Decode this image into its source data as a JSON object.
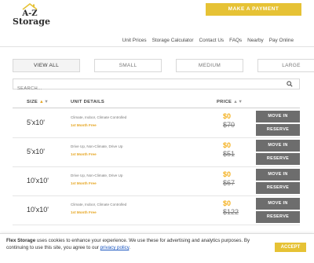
{
  "logo": {
    "line1": "A-Z",
    "line2": "Storage"
  },
  "header": {
    "pay_button": "MAKE A PAYMENT"
  },
  "nav": [
    "Unit Prices",
    "Storage Calculator",
    "Contact Us",
    "FAQs",
    "Nearby",
    "Pay Online"
  ],
  "tabs": [
    {
      "label": "VIEW ALL",
      "active": true
    },
    {
      "label": "SMALL",
      "active": false
    },
    {
      "label": "MEDIUM",
      "active": false
    },
    {
      "label": "LARGE",
      "active": false
    }
  ],
  "search": {
    "placeholder": "SEARCH..."
  },
  "table": {
    "headers": {
      "size": "SIZE",
      "details": "UNIT DETAILS",
      "price": "PRICE"
    },
    "move_in_label": "MOVE IN",
    "reserve_label": "RESERVE",
    "rows": [
      {
        "size": "5'x10'",
        "features": "Climate, Indoor, Climate Controlled",
        "promo": "1st Month Free",
        "price": "$0",
        "old_price": "$70"
      },
      {
        "size": "5'x10'",
        "features": "Drive Up, Non-Climate, Drive Up",
        "promo": "1st Month Free",
        "price": "$0",
        "old_price": "$51"
      },
      {
        "size": "10'x10'",
        "features": "Drive Up, Non-Climate, Drive Up",
        "promo": "1st Month Free",
        "price": "$0",
        "old_price": "$67"
      },
      {
        "size": "10'x10'",
        "features": "Climate, Indoor, Climate Controlled",
        "promo": "1st Month Free",
        "price": "$0",
        "old_price": "$122"
      }
    ]
  },
  "cookie": {
    "brand": "Flex Storage",
    "text1": " uses cookies to enhance your experience. We use these for advertising and analytics purposes. By continuing to use this site, you agree to our ",
    "link": "privacy policy",
    "text2": ".",
    "accept": "ACCEPT"
  },
  "colors": {
    "accent": "#e6c235",
    "price": "#f4b01e",
    "button": "#6d6d6d",
    "link": "#1a56c0"
  }
}
